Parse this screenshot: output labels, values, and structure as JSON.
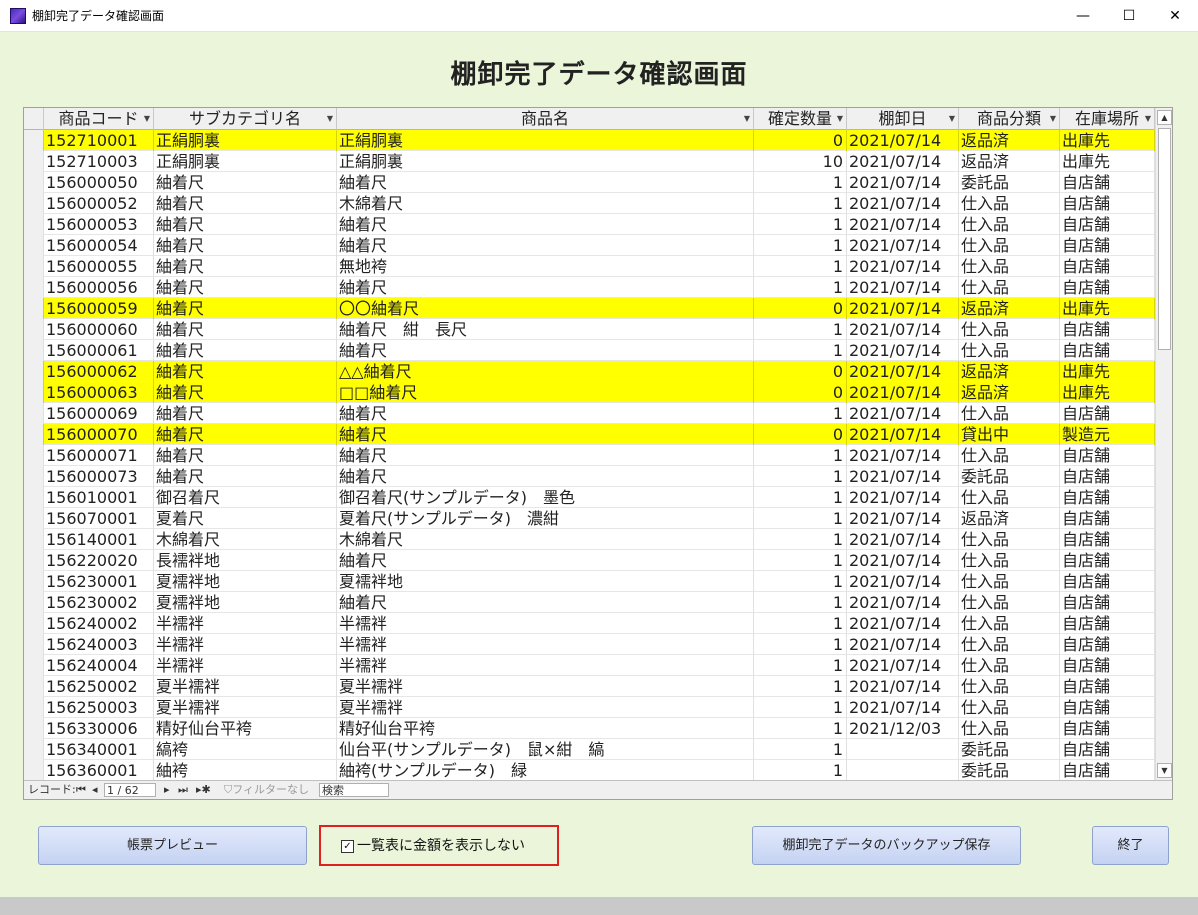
{
  "window": {
    "title": "棚卸完了データ確認画面",
    "min_glyph": "—",
    "max_glyph": "☐",
    "close_glyph": "✕"
  },
  "page": {
    "title": "棚卸完了データ確認画面"
  },
  "grid": {
    "columns": [
      "商品コード",
      "サブカテゴリ名",
      "商品名",
      "確定数量",
      "棚卸日",
      "商品分類",
      "在庫場所"
    ],
    "highlight_color": "#ffff00",
    "rows": [
      {
        "code": "152710001",
        "subcat": "正絹胴裏",
        "name": "正絹胴裏",
        "qty": "0",
        "date": "2021/07/14",
        "cls": "返品済",
        "loc": "出庫先",
        "hl": true
      },
      {
        "code": "152710003",
        "subcat": "正絹胴裏",
        "name": "正絹胴裏",
        "qty": "10",
        "date": "2021/07/14",
        "cls": "返品済",
        "loc": "出庫先",
        "hl": false
      },
      {
        "code": "156000050",
        "subcat": "紬着尺",
        "name": "紬着尺",
        "qty": "1",
        "date": "2021/07/14",
        "cls": "委託品",
        "loc": "自店舗",
        "hl": false
      },
      {
        "code": "156000052",
        "subcat": "紬着尺",
        "name": "木綿着尺",
        "qty": "1",
        "date": "2021/07/14",
        "cls": "仕入品",
        "loc": "自店舗",
        "hl": false
      },
      {
        "code": "156000053",
        "subcat": "紬着尺",
        "name": "紬着尺",
        "qty": "1",
        "date": "2021/07/14",
        "cls": "仕入品",
        "loc": "自店舗",
        "hl": false
      },
      {
        "code": "156000054",
        "subcat": "紬着尺",
        "name": "紬着尺",
        "qty": "1",
        "date": "2021/07/14",
        "cls": "仕入品",
        "loc": "自店舗",
        "hl": false
      },
      {
        "code": "156000055",
        "subcat": "紬着尺",
        "name": "無地袴",
        "qty": "1",
        "date": "2021/07/14",
        "cls": "仕入品",
        "loc": "自店舗",
        "hl": false
      },
      {
        "code": "156000056",
        "subcat": "紬着尺",
        "name": "紬着尺",
        "qty": "1",
        "date": "2021/07/14",
        "cls": "仕入品",
        "loc": "自店舗",
        "hl": false
      },
      {
        "code": "156000059",
        "subcat": "紬着尺",
        "name": "〇〇紬着尺",
        "qty": "0",
        "date": "2021/07/14",
        "cls": "返品済",
        "loc": "出庫先",
        "hl": true
      },
      {
        "code": "156000060",
        "subcat": "紬着尺",
        "name": "紬着尺　紺　長尺",
        "qty": "1",
        "date": "2021/07/14",
        "cls": "仕入品",
        "loc": "自店舗",
        "hl": false
      },
      {
        "code": "156000061",
        "subcat": "紬着尺",
        "name": "紬着尺",
        "qty": "1",
        "date": "2021/07/14",
        "cls": "仕入品",
        "loc": "自店舗",
        "hl": false
      },
      {
        "code": "156000062",
        "subcat": "紬着尺",
        "name": "△△紬着尺",
        "qty": "0",
        "date": "2021/07/14",
        "cls": "返品済",
        "loc": "出庫先",
        "hl": true
      },
      {
        "code": "156000063",
        "subcat": "紬着尺",
        "name": "□□紬着尺",
        "qty": "0",
        "date": "2021/07/14",
        "cls": "返品済",
        "loc": "出庫先",
        "hl": true
      },
      {
        "code": "156000069",
        "subcat": "紬着尺",
        "name": "紬着尺",
        "qty": "1",
        "date": "2021/07/14",
        "cls": "仕入品",
        "loc": "自店舗",
        "hl": false
      },
      {
        "code": "156000070",
        "subcat": "紬着尺",
        "name": "紬着尺",
        "qty": "0",
        "date": "2021/07/14",
        "cls": "貸出中",
        "loc": "製造元",
        "hl": true
      },
      {
        "code": "156000071",
        "subcat": "紬着尺",
        "name": "紬着尺",
        "qty": "1",
        "date": "2021/07/14",
        "cls": "仕入品",
        "loc": "自店舗",
        "hl": false
      },
      {
        "code": "156000073",
        "subcat": "紬着尺",
        "name": "紬着尺",
        "qty": "1",
        "date": "2021/07/14",
        "cls": "委託品",
        "loc": "自店舗",
        "hl": false
      },
      {
        "code": "156010001",
        "subcat": "御召着尺",
        "name": "御召着尺(サンプルデータ)　墨色",
        "qty": "1",
        "date": "2021/07/14",
        "cls": "仕入品",
        "loc": "自店舗",
        "hl": false
      },
      {
        "code": "156070001",
        "subcat": "夏着尺",
        "name": "夏着尺(サンプルデータ)　濃紺",
        "qty": "1",
        "date": "2021/07/14",
        "cls": "返品済",
        "loc": "自店舗",
        "hl": false
      },
      {
        "code": "156140001",
        "subcat": "木綿着尺",
        "name": "木綿着尺",
        "qty": "1",
        "date": "2021/07/14",
        "cls": "仕入品",
        "loc": "自店舗",
        "hl": false
      },
      {
        "code": "156220020",
        "subcat": "長襦袢地",
        "name": "紬着尺",
        "qty": "1",
        "date": "2021/07/14",
        "cls": "仕入品",
        "loc": "自店舗",
        "hl": false
      },
      {
        "code": "156230001",
        "subcat": "夏襦袢地",
        "name": "夏襦袢地",
        "qty": "1",
        "date": "2021/07/14",
        "cls": "仕入品",
        "loc": "自店舗",
        "hl": false
      },
      {
        "code": "156230002",
        "subcat": "夏襦袢地",
        "name": "紬着尺",
        "qty": "1",
        "date": "2021/07/14",
        "cls": "仕入品",
        "loc": "自店舗",
        "hl": false
      },
      {
        "code": "156240002",
        "subcat": "半襦袢",
        "name": "半襦袢",
        "qty": "1",
        "date": "2021/07/14",
        "cls": "仕入品",
        "loc": "自店舗",
        "hl": false
      },
      {
        "code": "156240003",
        "subcat": "半襦袢",
        "name": "半襦袢",
        "qty": "1",
        "date": "2021/07/14",
        "cls": "仕入品",
        "loc": "自店舗",
        "hl": false
      },
      {
        "code": "156240004",
        "subcat": "半襦袢",
        "name": "半襦袢",
        "qty": "1",
        "date": "2021/07/14",
        "cls": "仕入品",
        "loc": "自店舗",
        "hl": false
      },
      {
        "code": "156250002",
        "subcat": "夏半襦袢",
        "name": "夏半襦袢",
        "qty": "1",
        "date": "2021/07/14",
        "cls": "仕入品",
        "loc": "自店舗",
        "hl": false
      },
      {
        "code": "156250003",
        "subcat": "夏半襦袢",
        "name": "夏半襦袢",
        "qty": "1",
        "date": "2021/07/14",
        "cls": "仕入品",
        "loc": "自店舗",
        "hl": false
      },
      {
        "code": "156330006",
        "subcat": "精好仙台平袴",
        "name": "精好仙台平袴",
        "qty": "1",
        "date": "2021/12/03",
        "cls": "仕入品",
        "loc": "自店舗",
        "hl": false
      },
      {
        "code": "156340001",
        "subcat": "縞袴",
        "name": "仙台平(サンプルデータ)　鼠×紺　縞",
        "qty": "1",
        "date": "",
        "cls": "委託品",
        "loc": "自店舗",
        "hl": false
      },
      {
        "code": "156360001",
        "subcat": "紬袴",
        "name": "紬袴(サンプルデータ)　緑",
        "qty": "1",
        "date": "",
        "cls": "委託品",
        "loc": "自店舗",
        "hl": false
      }
    ]
  },
  "navigation": {
    "record_label": "レコード:",
    "first_glyph": "⏮",
    "prev_glyph": "◂",
    "position": "1 / 62",
    "next_glyph": "▸",
    "last_glyph": "⏭",
    "new_glyph": "▸✱",
    "filter_label": "フィルターなし",
    "search_label": "検索"
  },
  "buttons": {
    "preview": "帳票プレビュー",
    "backup": "棚卸完了データのバックアップ保存",
    "exit": "終了"
  },
  "option": {
    "checked_glyph": "✓",
    "label": "一覧表に金額を表示しない"
  },
  "colors": {
    "background": "#ebf5d9",
    "highlight": "#ffff00",
    "button": "#c4d2f2",
    "option_border": "#e02020"
  }
}
